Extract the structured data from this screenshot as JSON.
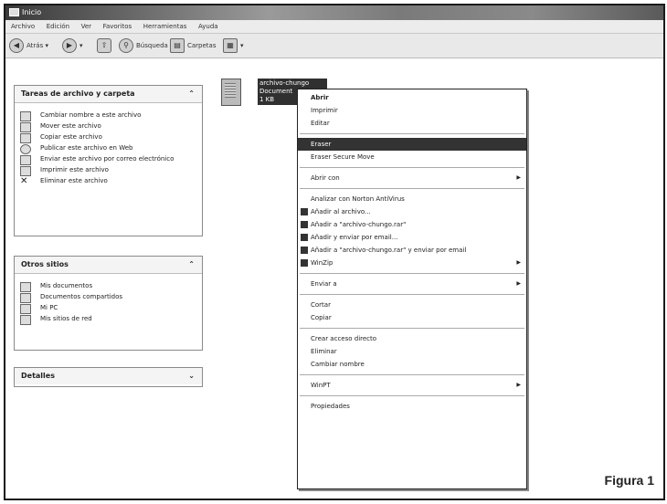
{
  "window": {
    "title": "Inicio"
  },
  "menubar": [
    "Archivo",
    "Edición",
    "Ver",
    "Favoritos",
    "Herramientas",
    "Ayuda"
  ],
  "toolbar": {
    "back_label": "Atrás",
    "search_label": "Búsqueda",
    "folders_label": "Carpetas"
  },
  "tasks_panel": {
    "title": "Tareas de archivo y carpeta",
    "items": [
      "Cambiar nombre a este archivo",
      "Mover este archivo",
      "Copiar este archivo",
      "Publicar este archivo en Web",
      "Enviar este archivo por correo electrónico",
      "Imprimir este archivo",
      "Eliminar este archivo"
    ]
  },
  "other_places": {
    "title": "Otros sitios",
    "items": [
      "Mis documentos",
      "Documentos compartidos",
      "Mi PC",
      "Mis sitios de red"
    ]
  },
  "details": {
    "title": "Detalles"
  },
  "file": {
    "name": "archivo-chungo",
    "type": "Document",
    "size": "1 KB"
  },
  "context_menu": {
    "items": [
      {
        "label": "Abrir",
        "bold": true
      },
      {
        "label": "Imprimir"
      },
      {
        "label": "Editar"
      },
      {
        "sep": true
      },
      {
        "label": "Eraser",
        "highlight": true
      },
      {
        "label": "Eraser Secure Move"
      },
      {
        "sep": true
      },
      {
        "label": "Abrir con",
        "arrow": true
      },
      {
        "sep": true
      },
      {
        "label": "Analizar con Norton AntiVirus"
      },
      {
        "label": "Añadir al archivo...",
        "icon": true
      },
      {
        "label": "Añadir a \"archivo-chungo.rar\"",
        "icon": true
      },
      {
        "label": "Añadir y enviar por email...",
        "icon": true
      },
      {
        "label": "Añadir a \"archivo-chungo.rar\" y enviar por email",
        "icon": true
      },
      {
        "label": "WinZip",
        "icon": true,
        "arrow": true
      },
      {
        "sep": true
      },
      {
        "label": "Enviar a",
        "arrow": true
      },
      {
        "sep": true
      },
      {
        "label": "Cortar"
      },
      {
        "label": "Copiar"
      },
      {
        "sep": true
      },
      {
        "label": "Crear acceso directo"
      },
      {
        "label": "Eliminar"
      },
      {
        "label": "Cambiar nombre"
      },
      {
        "sep": true
      },
      {
        "label": "WinPT",
        "arrow": true
      },
      {
        "sep": true
      },
      {
        "label": "Propiedades"
      }
    ]
  },
  "caption": "Figura 1"
}
